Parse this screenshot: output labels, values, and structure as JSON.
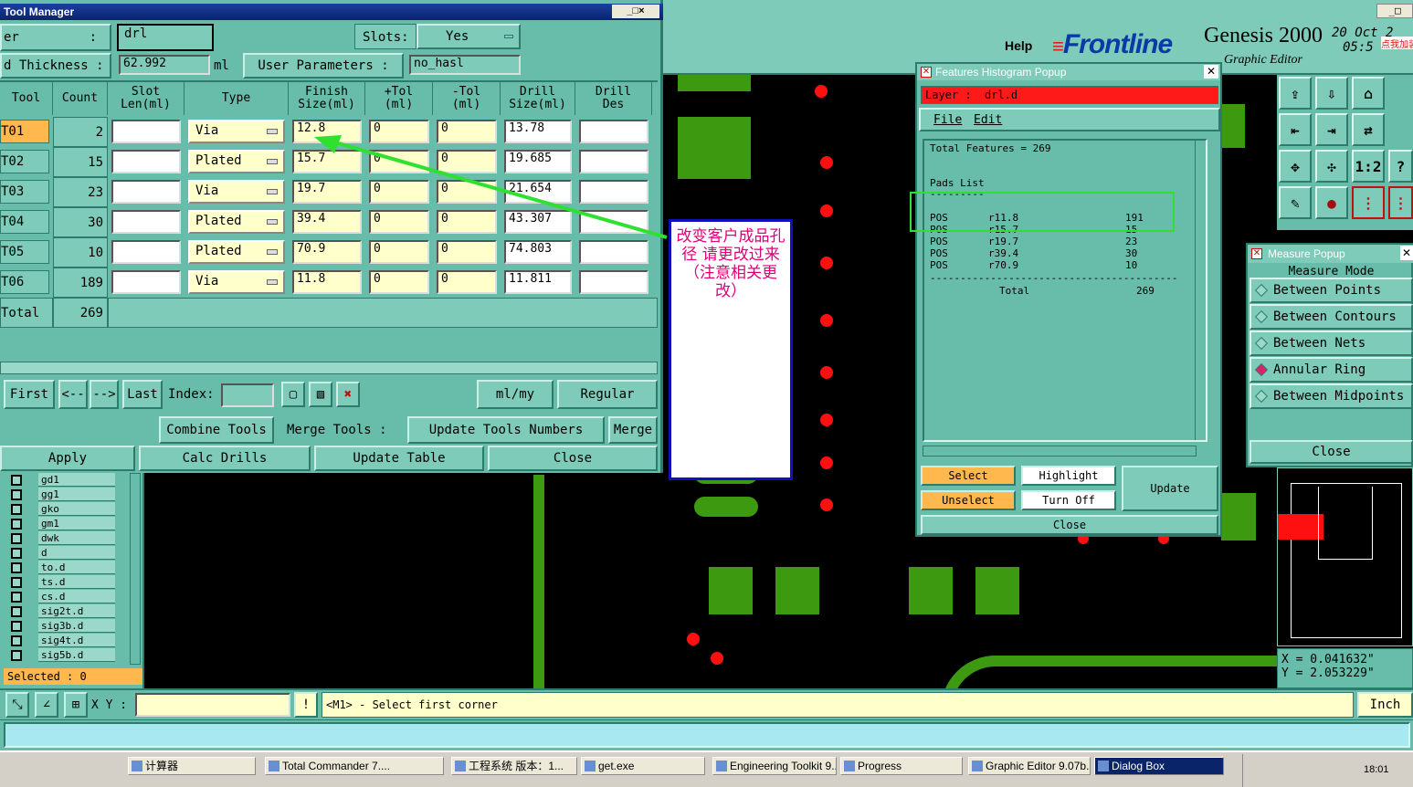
{
  "tool_manager": {
    "title": "Tool Manager",
    "layer_label": "er",
    "layer_sep": ":",
    "layer_value": "drl",
    "slots_label": "Slots:",
    "slots_value": "Yes",
    "thickness_label": "d Thickness :",
    "thickness_value": "62.992",
    "thickness_unit": "ml",
    "user_params_label": "User Parameters :",
    "user_params_value": "no_hasl",
    "headers": [
      "Tool",
      "Count",
      "Slot\nLen(ml)",
      "Type",
      "Finish\nSize(ml)",
      "+Tol\n(ml)",
      "-Tol\n(ml)",
      "Drill\nSize(ml)",
      "Drill\nDes"
    ],
    "rows": [
      {
        "tool": "T01",
        "count": "2",
        "type": "Via",
        "finish": "12.8",
        "ptol": "0",
        "mtol": "0",
        "drill": "13.78"
      },
      {
        "tool": "T02",
        "count": "15",
        "type": "Plated",
        "finish": "15.7",
        "ptol": "0",
        "mtol": "0",
        "drill": "19.685"
      },
      {
        "tool": "T03",
        "count": "23",
        "type": "Via",
        "finish": "19.7",
        "ptol": "0",
        "mtol": "0",
        "drill": "21.654"
      },
      {
        "tool": "T04",
        "count": "30",
        "type": "Plated",
        "finish": "39.4",
        "ptol": "0",
        "mtol": "0",
        "drill": "43.307"
      },
      {
        "tool": "T05",
        "count": "10",
        "type": "Plated",
        "finish": "70.9",
        "ptol": "0",
        "mtol": "0",
        "drill": "74.803"
      },
      {
        "tool": "T06",
        "count": "189",
        "type": "Via",
        "finish": "11.8",
        "ptol": "0",
        "mtol": "0",
        "drill": "11.811"
      }
    ],
    "total_label": "Total",
    "total_value": "269",
    "nav": {
      "first": "First",
      "prev": "<--",
      "next": "-->",
      "last": "Last",
      "index_label": "Index:",
      "units": "ml/my",
      "mode": "Regular"
    },
    "buttons": {
      "combine": "Combine Tools",
      "merge_label": "Merge Tools :",
      "update_numbers": "Update Tools Numbers",
      "merge": "Merge",
      "apply": "Apply",
      "calc": "Calc Drills",
      "update_table": "Update Table",
      "close": "Close"
    }
  },
  "annotation": "改变客户成品孔径  请更改过来（注意相关更改）",
  "header": {
    "help": "Help",
    "brand": "Frontline",
    "product": "Genesis 2000",
    "subtitle": "Graphic Editor",
    "date": "20 Oct 2",
    "time": "05:5",
    "tag": "点我加装"
  },
  "histogram": {
    "title": "Features Histogram Popup",
    "layer_label": "Layer :",
    "layer_value": "drl.d",
    "menu": [
      "File",
      "Edit"
    ],
    "total_features": "Total Features = 269",
    "pads_list": "Pads List",
    "underline": "---------",
    "rows": [
      {
        "kind": "POS",
        "sym": "r11.8",
        "count": "191"
      },
      {
        "kind": "POS",
        "sym": "r15.7",
        "count": "15"
      },
      {
        "kind": "POS",
        "sym": "r19.7",
        "count": "23"
      },
      {
        "kind": "POS",
        "sym": "r39.4",
        "count": "30"
      },
      {
        "kind": "POS",
        "sym": "r70.9",
        "count": "10"
      }
    ],
    "divider": "-----------------------------------------",
    "total_label": "Total",
    "total_value": "269",
    "buttons": {
      "select": "Select",
      "highlight": "Highlight",
      "update": "Update",
      "unselect": "Unselect",
      "turn_off": "Turn Off",
      "close": "Close"
    }
  },
  "measure": {
    "title": "Measure Popup",
    "mode_label": "Measure Mode",
    "modes": [
      "Between Points",
      "Between Contours",
      "Between Nets",
      "Annular Ring",
      "Between Midpoints"
    ],
    "selected_mode": "Annular Ring",
    "close": "Close",
    "x_readout": "X =  0.041632\"",
    "y_readout": "Y =  2.053229\""
  },
  "toolbar_icons": [
    "1:2",
    "?"
  ],
  "layers": {
    "items": [
      "gd1",
      "gg1",
      "gko",
      "gm1",
      "dwk",
      "d",
      "to.d",
      "ts.d",
      "cs.d",
      "sig2t.d",
      "sig3b.d",
      "sig4t.d",
      "sig5b.d"
    ],
    "selected": "Selected : 0"
  },
  "bottom": {
    "xy_label": "X Y :",
    "status": "<M1> - Select first corner",
    "units": "Inch"
  },
  "taskbar": {
    "row1": [
      "计算器",
      "Total Commander 7....",
      "工程系统  版本：1...",
      "get.exe",
      "Engineering Toolkit 9...",
      "Progress",
      "Graphic Editor 9.07b...",
      "Dialog Box"
    ],
    "clock": "18:01"
  },
  "colors": {
    "panel": "#67bdaa",
    "button": "#7ecbb9",
    "pad_green": "#3d9a10",
    "pad_red": "#ff1010",
    "select_orange": "#ffb84d",
    "layer_red": "#ff1a1a",
    "annotation": "#e0007a",
    "arrow": "#30e030"
  }
}
